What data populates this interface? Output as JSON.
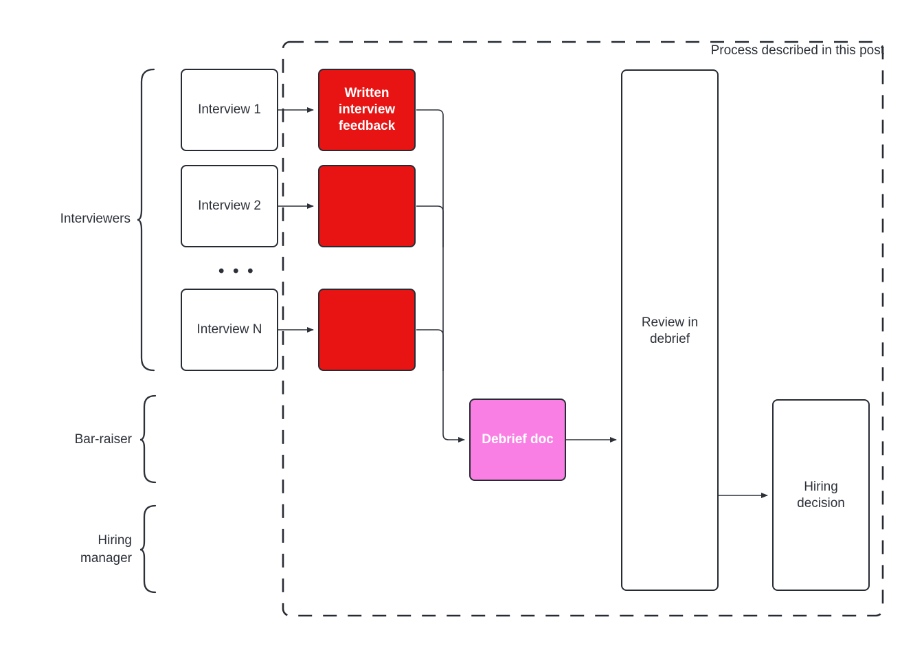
{
  "diagram": {
    "title_label": "Process described in this post",
    "boundary": {
      "style": "dashed",
      "color": "#262b33"
    },
    "groups": [
      {
        "id": "interviewers",
        "label": "Interviewers"
      },
      {
        "id": "bar-raiser",
        "label": "Bar-raiser"
      },
      {
        "id": "hiring-manager",
        "label": "Hiring\nmanager"
      }
    ],
    "ellipsis": "• • •",
    "nodes": [
      {
        "id": "interview-1",
        "label": "Interview 1",
        "fill": "#ffffff",
        "text_color": "#2c3038"
      },
      {
        "id": "interview-2",
        "label": "Interview 2",
        "fill": "#ffffff",
        "text_color": "#2c3038"
      },
      {
        "id": "interview-n",
        "label": "Interview N",
        "fill": "#ffffff",
        "text_color": "#2c3038"
      },
      {
        "id": "written-feedback-1",
        "label": "Written\ninterview\nfeedback",
        "fill": "#e81414",
        "text_color": "#ffffff"
      },
      {
        "id": "written-feedback-2",
        "label": "",
        "fill": "#e81414",
        "text_color": "#ffffff"
      },
      {
        "id": "written-feedback-n",
        "label": "",
        "fill": "#e81414",
        "text_color": "#ffffff"
      },
      {
        "id": "debrief-doc",
        "label": "Debrief doc",
        "fill": "#fa7fe4",
        "text_color": "#ffffff"
      },
      {
        "id": "review-in-debrief",
        "label": "Review in\ndebrief",
        "fill": "#ffffff",
        "text_color": "#2c3038"
      },
      {
        "id": "hiring-decision",
        "label": "Hiring\ndecision",
        "fill": "#ffffff",
        "text_color": "#2c3038"
      }
    ],
    "edges": [
      {
        "from": "interview-1",
        "to": "written-feedback-1"
      },
      {
        "from": "interview-2",
        "to": "written-feedback-2"
      },
      {
        "from": "interview-n",
        "to": "written-feedback-n"
      },
      {
        "from": "written-feedback-1",
        "to": "debrief-doc"
      },
      {
        "from": "written-feedback-2",
        "to": "debrief-doc"
      },
      {
        "from": "written-feedback-n",
        "to": "debrief-doc"
      },
      {
        "from": "debrief-doc",
        "to": "review-in-debrief"
      },
      {
        "from": "review-in-debrief",
        "to": "hiring-decision"
      }
    ]
  }
}
